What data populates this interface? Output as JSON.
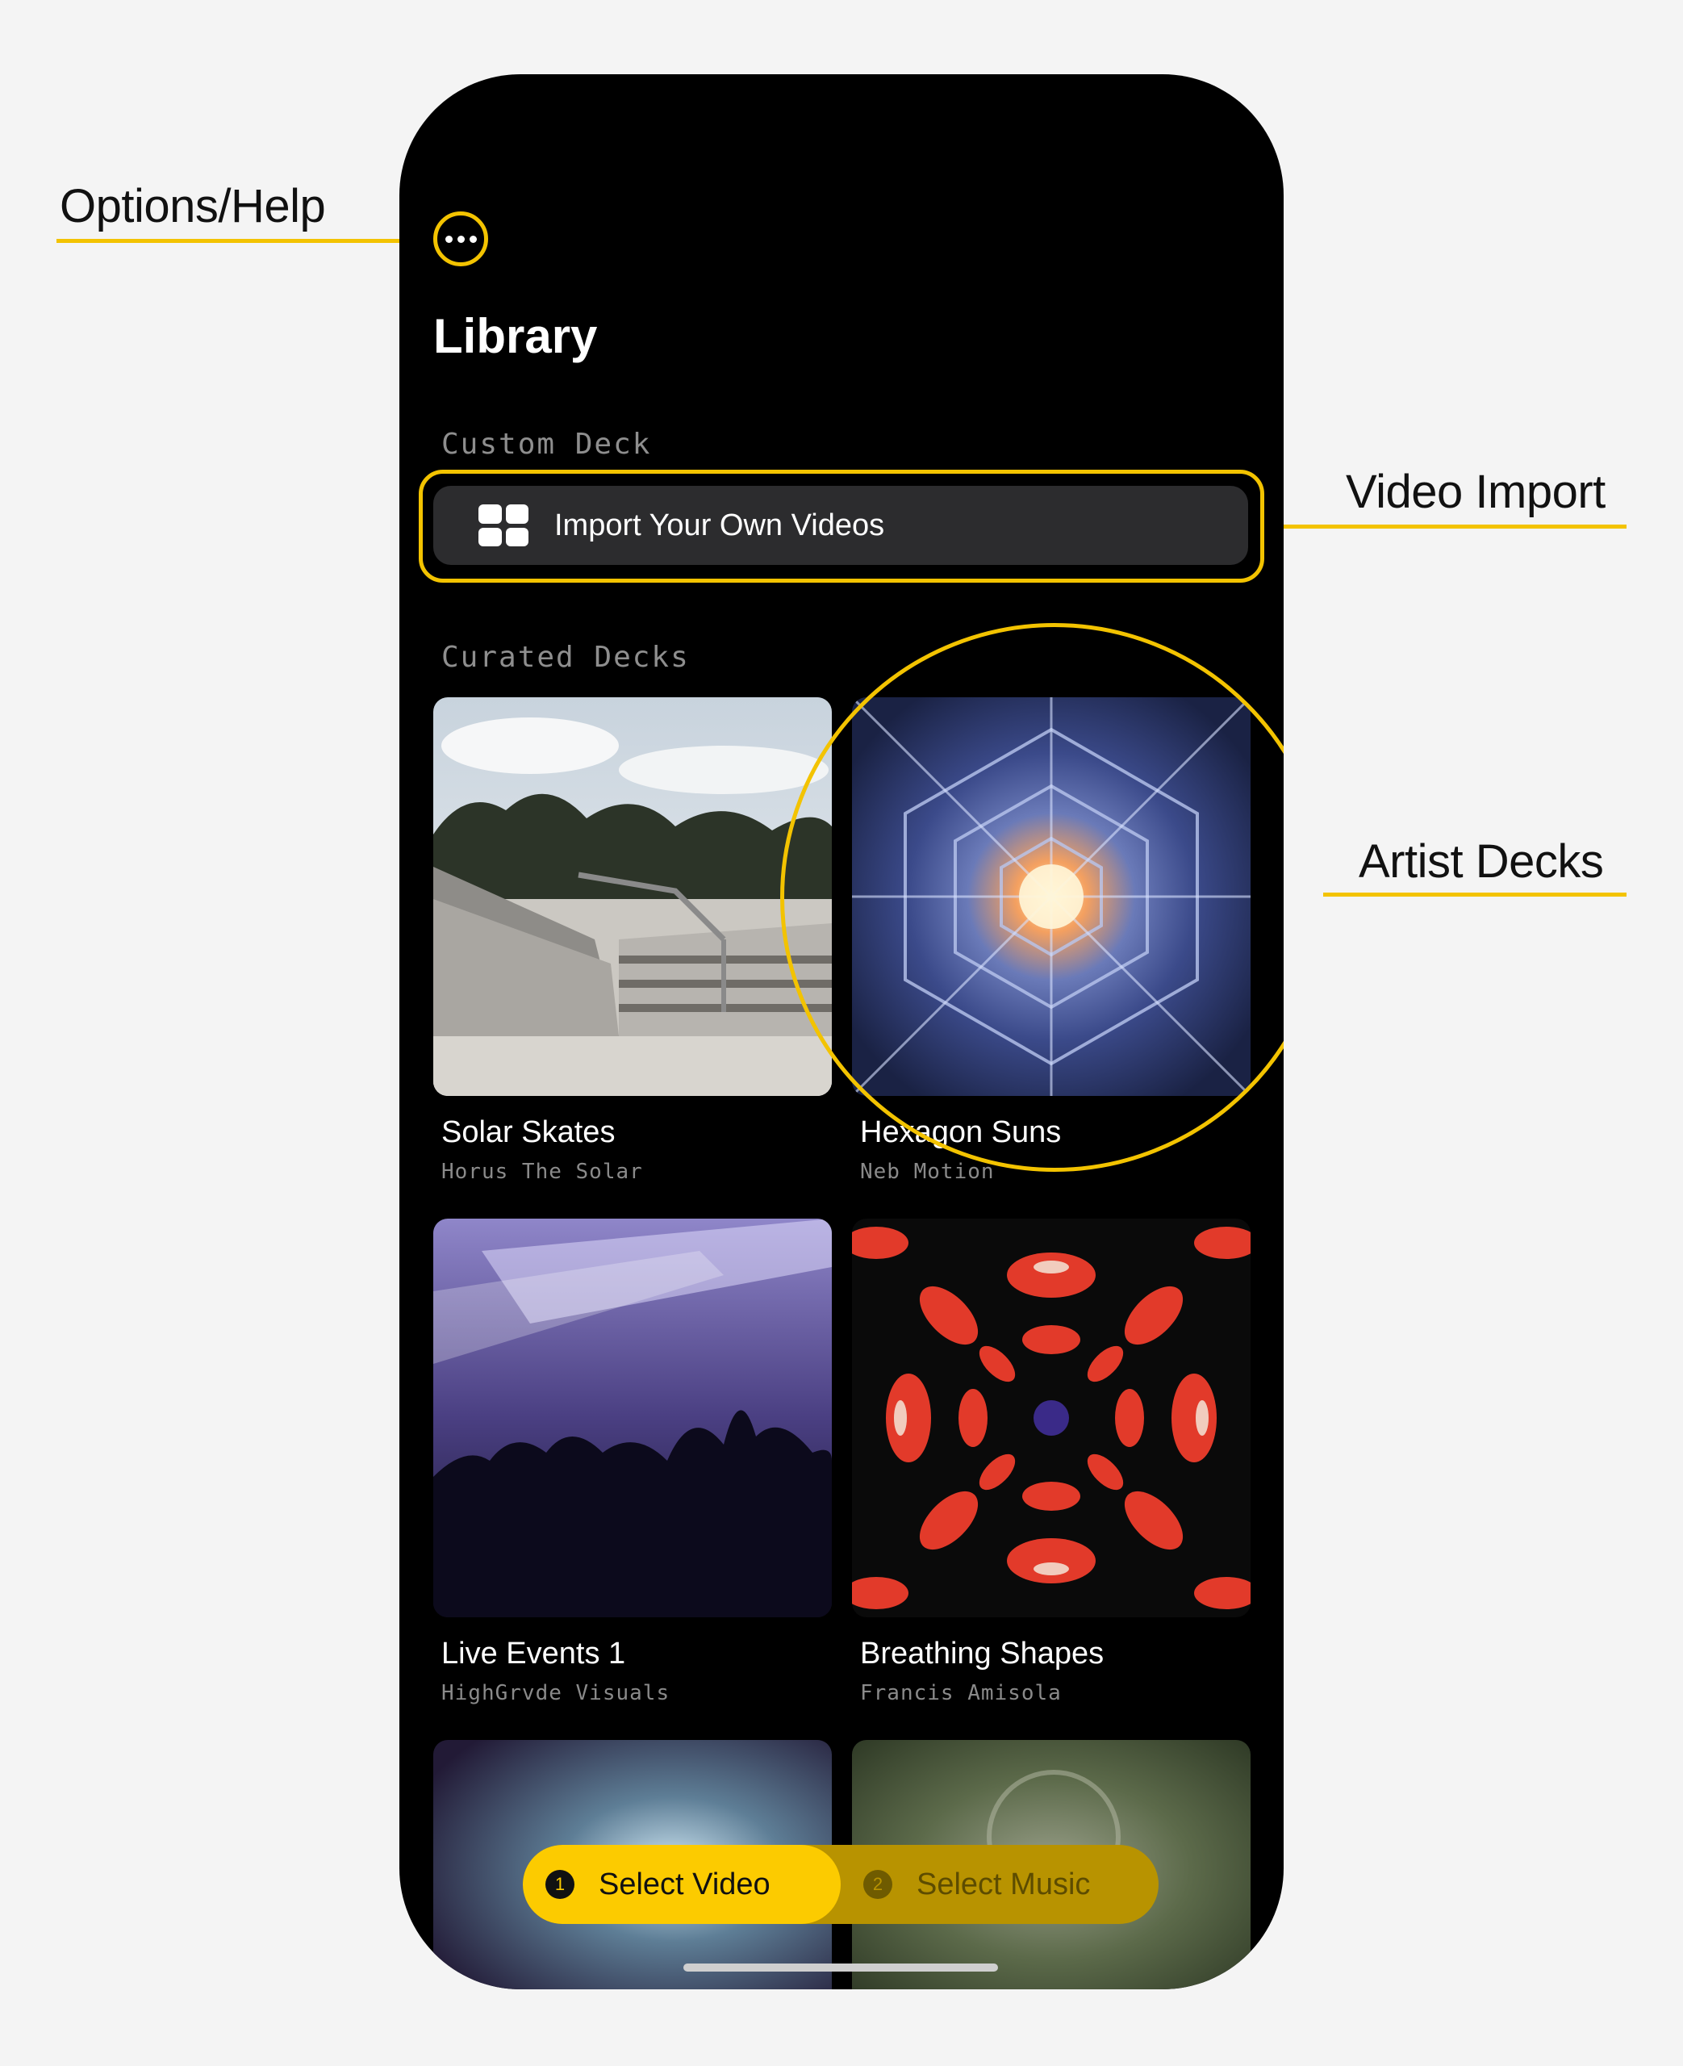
{
  "annotations": {
    "options_help": "Options/Help",
    "video_import": "Video Import",
    "artist_decks": "Artist Decks"
  },
  "screen": {
    "title": "Library",
    "custom_deck_heading": "Custom Deck",
    "import_button_label": "Import Your Own Videos",
    "curated_heading": "Curated Decks",
    "decks": [
      {
        "title": "Solar Skates",
        "artist": "Horus The Solar"
      },
      {
        "title": "Hexagon Suns",
        "artist": "Neb Motion"
      },
      {
        "title": "Live Events 1",
        "artist": "HighGrvde Visuals"
      },
      {
        "title": "Breathing Shapes",
        "artist": "Francis Amisola"
      }
    ],
    "bottom_nav": {
      "step1_number": "1",
      "step1_label": "Select Video",
      "step2_number": "2",
      "step2_label": "Select Music"
    }
  },
  "icons": {
    "more": "more-horizontal-icon",
    "import": "grid-icon"
  },
  "colors": {
    "accent": "#fccb00",
    "annotation": "#f3c300",
    "background": "#000000",
    "card_button": "#2c2c2e"
  }
}
